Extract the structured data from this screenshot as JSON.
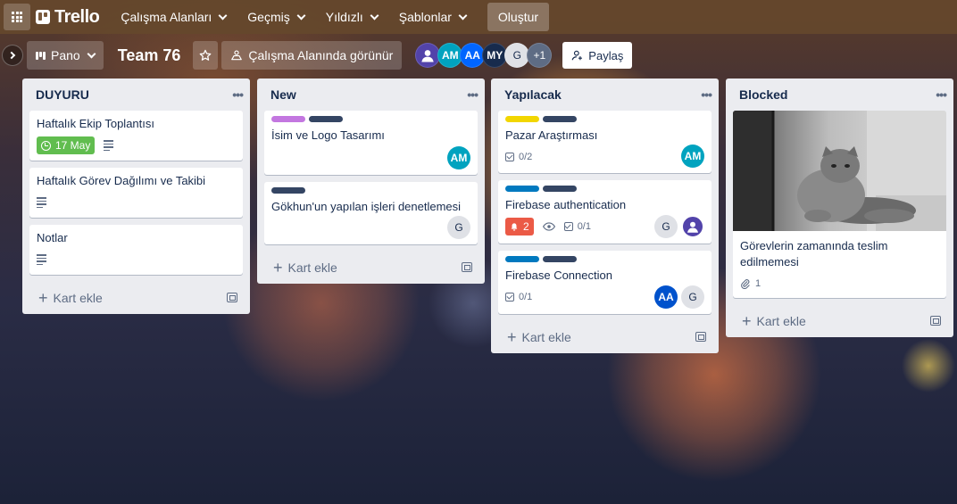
{
  "topbar": {
    "app_name": "Trello",
    "nav": [
      "Çalışma Alanları",
      "Geçmiş",
      "Yıldızlı",
      "Şablonlar"
    ],
    "create_label": "Oluştur"
  },
  "board": {
    "view_label": "Pano",
    "title": "Team 76",
    "visibility_label": "Çalışma Alanında görünür",
    "members": [
      {
        "initials": "",
        "color": "#5243aa",
        "type": "photo"
      },
      {
        "initials": "AM",
        "color": "#00a3bf"
      },
      {
        "initials": "AA",
        "color": "#0065ff"
      },
      {
        "initials": "MY",
        "color": "#172b4d"
      },
      {
        "initials": "G",
        "color": "#dfe1e6"
      }
    ],
    "more_members": "+1",
    "share_label": "Paylaş"
  },
  "colors": {
    "green": "#61bd4f",
    "purple": "#c377e0",
    "navy": "#344563",
    "yellow": "#f2d600",
    "blue": "#0079bf",
    "red": "#eb5a46",
    "teal": "#00a3bf"
  },
  "lists": [
    {
      "title": "DUYURU",
      "cards": [
        {
          "title": "Haftalık Ekip Toplantısı",
          "due": "17 May"
        },
        {
          "title": "Haftalık Görev Dağılımı ve Takibi"
        },
        {
          "title": "Notlar"
        }
      ],
      "add_label": "Kart ekle"
    },
    {
      "title": "New",
      "cards": [
        {
          "title": "İsim ve Logo Tasarımı",
          "member": "AM"
        },
        {
          "title": "Gökhun'un yapılan işleri denetlemesi",
          "member": "G"
        }
      ],
      "add_label": "Kart ekle"
    },
    {
      "title": "Yapılacak",
      "cards": [
        {
          "title": "Pazar Araştırması",
          "checklist": "0/2",
          "member": "AM"
        },
        {
          "title": "Firebase authentication",
          "notifications": "2",
          "checklist": "0/1",
          "member": "G"
        },
        {
          "title": "Firebase Connection",
          "checklist": "0/1",
          "members": [
            "AA",
            "G"
          ]
        }
      ],
      "add_label": "Kart ekle"
    },
    {
      "title": "Blocked",
      "cards": [
        {
          "title": "Görevlerin zamanında teslim edilmemesi",
          "attachments": "1"
        }
      ],
      "add_label": "Kart ekle"
    }
  ]
}
